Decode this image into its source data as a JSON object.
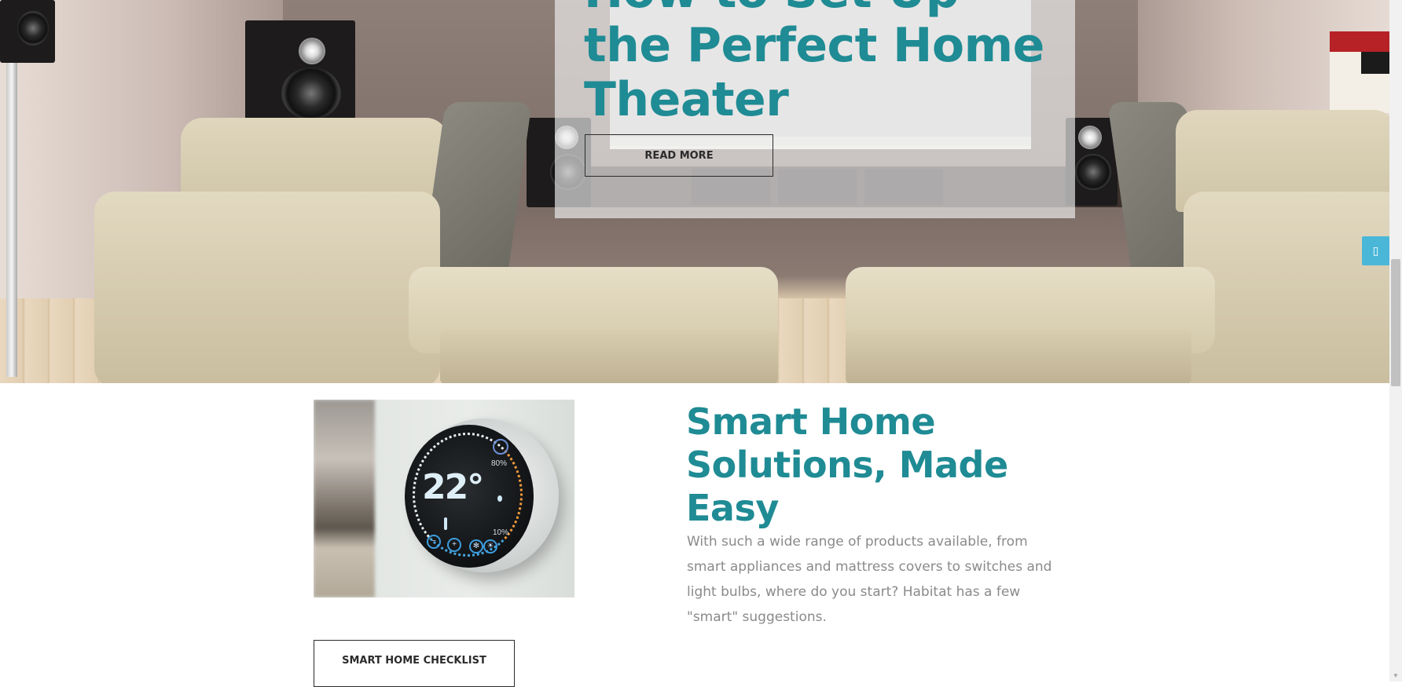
{
  "hero": {
    "title": "How to Set Up the Perfect Home Theater",
    "cta_label": "READ MORE"
  },
  "side_tab": {
    "icon": "square-icon",
    "glyph": "▯"
  },
  "smart_home": {
    "title": "Smart Home Solutions, Made Easy",
    "body": "With such a wide range of products available, from smart appliances and mattress covers to switches and light bulbs, where do you start? Habitat has a few \"smart\" suggestions.",
    "cta_label": "SMART HOME CHECKLIST",
    "image": {
      "temperature": "22°",
      "humidity_high": "80%",
      "humidity_low": "10%",
      "buttons": [
        "−",
        "+",
        "✻",
        "☀"
      ]
    }
  },
  "colors": {
    "accent": "#1f8b94",
    "side_tab": "#4ab7d8",
    "body_text": "#8a8a8a"
  }
}
